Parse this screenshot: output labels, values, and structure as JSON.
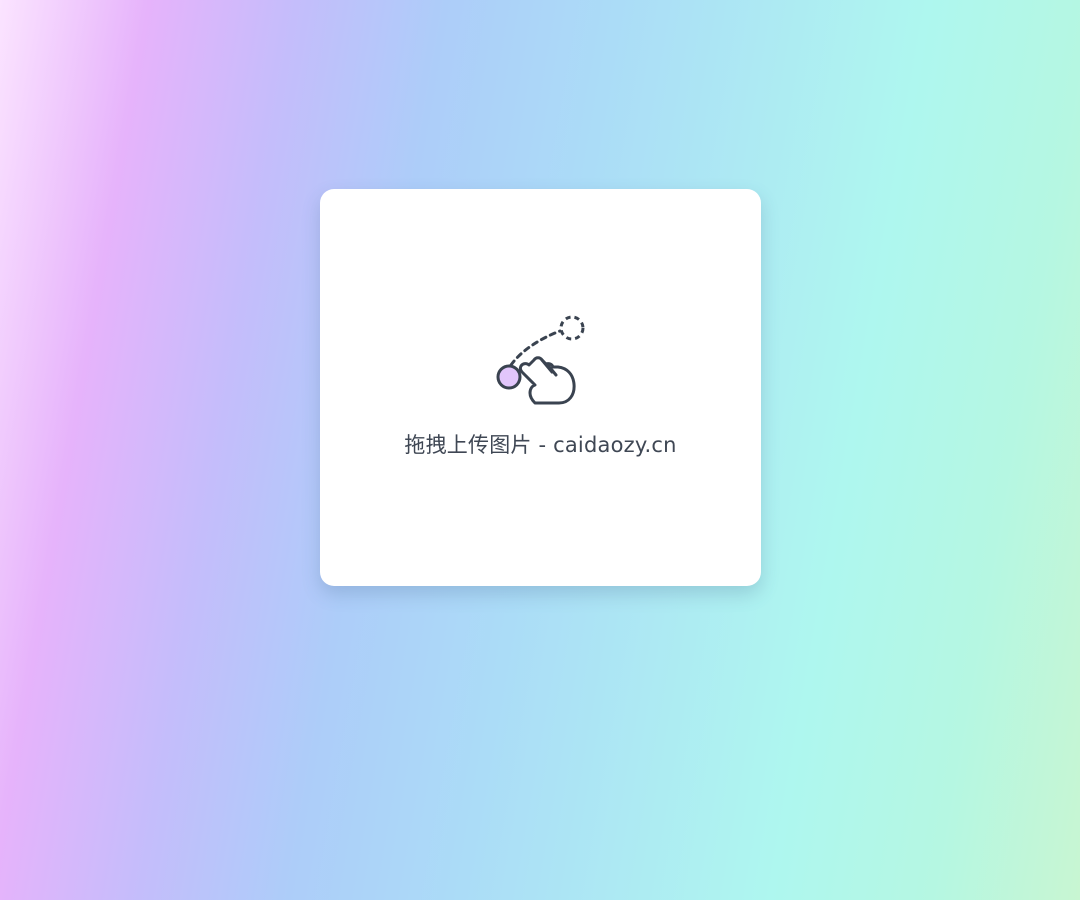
{
  "dropzone": {
    "label": "拖拽上传图片 - caidaozy.cn",
    "icon": "drag-drop-hand-icon"
  },
  "colors": {
    "icon_stroke": "#3a4350",
    "dot_fill": "#e2c6fb",
    "card_background": "#ffffff",
    "text": "#3f4754"
  }
}
